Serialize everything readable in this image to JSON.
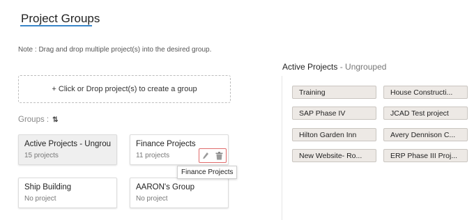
{
  "header": {
    "title": "Project Groups"
  },
  "note": "Note : Drag and drop multiple project(s) into the desired group.",
  "drop_zone": {
    "label": "+ Click or Drop project(s) to create a group"
  },
  "groups_section": {
    "label": "Groups :",
    "sort_icon": "⇅"
  },
  "groups": [
    {
      "name": "Active Projects - Ungrou...",
      "count": "15 projects"
    },
    {
      "name": "Finance Projects",
      "count": "11 projects"
    },
    {
      "name": "Ship Building",
      "count": "No project"
    },
    {
      "name": "AARON's Group",
      "count": "No project"
    }
  ],
  "tooltip": "Finance Projects",
  "active_panel": {
    "title": "Active Projects",
    "subtitle": "- Ungrouped",
    "projects": [
      "Training",
      "House Constructi...",
      "SAP Phase IV",
      "JCAD Test project",
      "Hilton Garden Inn",
      "Avery Dennison C...",
      "New Website- Ro...",
      "ERP Phase III Proj..."
    ]
  },
  "colors": {
    "accent": "#3a86c8",
    "action_border": "#e06b6b",
    "pill_bg": "#ede9e5"
  },
  "icons": {
    "edit": "pencil-icon",
    "delete": "trash-icon",
    "sort": "sort-icon"
  }
}
